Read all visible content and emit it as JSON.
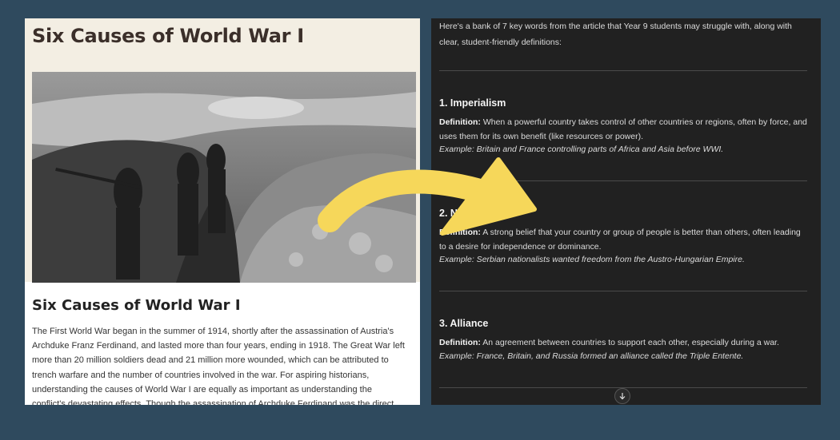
{
  "article": {
    "header_title": "Six Causes of World War I",
    "subtitle": "Six Causes of World War I",
    "body": "The First World War began in the summer of 1914, shortly after the assassination of Austria's Archduke Franz Ferdinand, and lasted more than four years, ending in 1918. The Great War left more than 20 million soldiers dead and 21 million more wounded, which can be attributed to trench warfare and the number of countries involved in the war. For aspiring historians, understanding the causes of World War I are equally as important as understanding the conflict's devastating effects. Though the assassination of Archduke Ferdinand was the direct precipitating event leading to the declaration of war, there were"
  },
  "chat": {
    "intro": "Here's a bank of 7 key words from the article that Year 9 students may struggle with, along with clear, student-friendly definitions:",
    "definition_label": "Definition:",
    "terms": [
      {
        "heading": "1. Imperialism",
        "definition": "When a powerful country takes control of other countries or regions, often by force, and uses them for its own benefit (like resources or power).",
        "example": "Example: Britain and France controlling parts of Africa and Asia before WWI."
      },
      {
        "heading": "2. N",
        "definition": "A strong belief that your country or group of people is better than others, often leading to a desire for independence or dominance.",
        "example": "Example: Serbian nationalists wanted freedom from the Austro-Hungarian Empire."
      },
      {
        "heading": "3. Alliance",
        "definition": "An agreement between countries to support each other, especially during a war.",
        "example": "Example: France, Britain, and Russia formed an alliance called the Triple Entente."
      }
    ]
  },
  "icons": {
    "scroll_down": "arrow-down-icon",
    "overlay_arrow": "curved-arrow-icon"
  },
  "colors": {
    "background": "#2f4a5e",
    "chat_bg": "#212121",
    "arrow": "#f6d75a"
  }
}
